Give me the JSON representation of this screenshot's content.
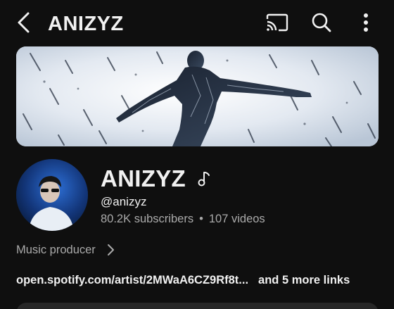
{
  "appbar": {
    "title": "ANIZYZ",
    "back_icon": "chevron-left-icon",
    "cast_icon": "cast-icon",
    "search_icon": "search-icon",
    "more_icon": "more-vert-icon"
  },
  "channel": {
    "name": "ANIZYZ",
    "badge_icon": "music-note-icon",
    "handle": "@anizyz",
    "subscribers": "80.2K subscribers",
    "separator": "•",
    "videos": "107 videos",
    "description": "Music producer",
    "description_icon": "chevron-right-icon",
    "link_text": "open.spotify.com/artist/2MWaA6CZ9Rf8t...",
    "more_links": "and 5 more links"
  },
  "colors": {
    "background": "#0f0f0f",
    "text_primary": "#f1f1f1",
    "text_secondary": "#aaaaaa"
  }
}
